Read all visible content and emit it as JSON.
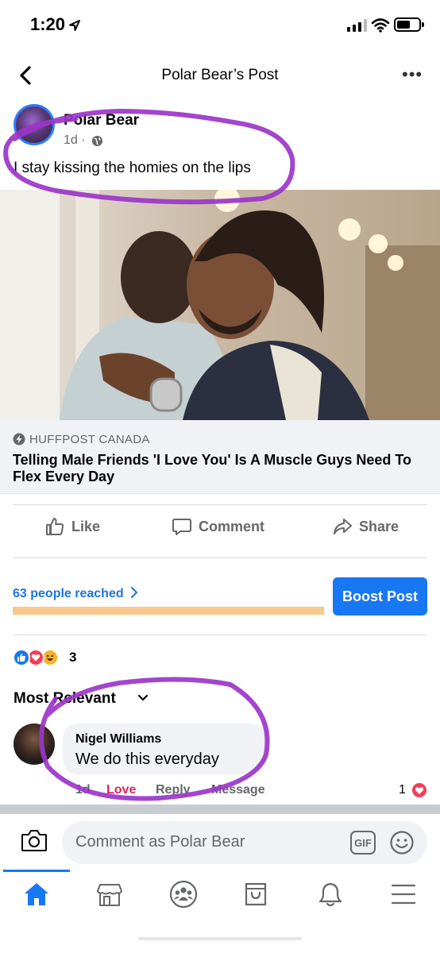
{
  "status_bar": {
    "time": "1:20"
  },
  "header": {
    "title": "Polar Bear’s Post"
  },
  "post": {
    "author": "Polar Bear",
    "time": "1d ·",
    "text": "I stay kissing the homies on the lips",
    "link": {
      "source": "HUFFPOST CANADA",
      "title": "Telling Male Friends 'I Love You' Is A Muscle Guys Need To Flex Every Day"
    }
  },
  "actions": {
    "like": "Like",
    "comment": "Comment",
    "share": "Share"
  },
  "reach": {
    "text": "63 people reached",
    "boost_label": "Boost Post",
    "progress": 1.0
  },
  "reactions": {
    "count": "3",
    "types": [
      "like",
      "love",
      "haha"
    ]
  },
  "comments_sort": "Most Relevant",
  "comment": {
    "author": "Nigel Williams",
    "text": "We do this everyday",
    "time": "1d",
    "love_label": "Love",
    "reply_label": "Reply",
    "message_label": "Message",
    "reaction_count": "1"
  },
  "composer": {
    "placeholder": "Comment as Polar Bear",
    "gif_label": "GIF"
  },
  "tabs": [
    "home-icon",
    "marketplace-icon",
    "groups-icon",
    "shop-icon",
    "notifications-icon",
    "menu-icon"
  ],
  "colors": {
    "accent": "#1877f2",
    "love": "#e0245e",
    "annotation": "#9b35c9",
    "reach_bar": "#f7c98c"
  }
}
